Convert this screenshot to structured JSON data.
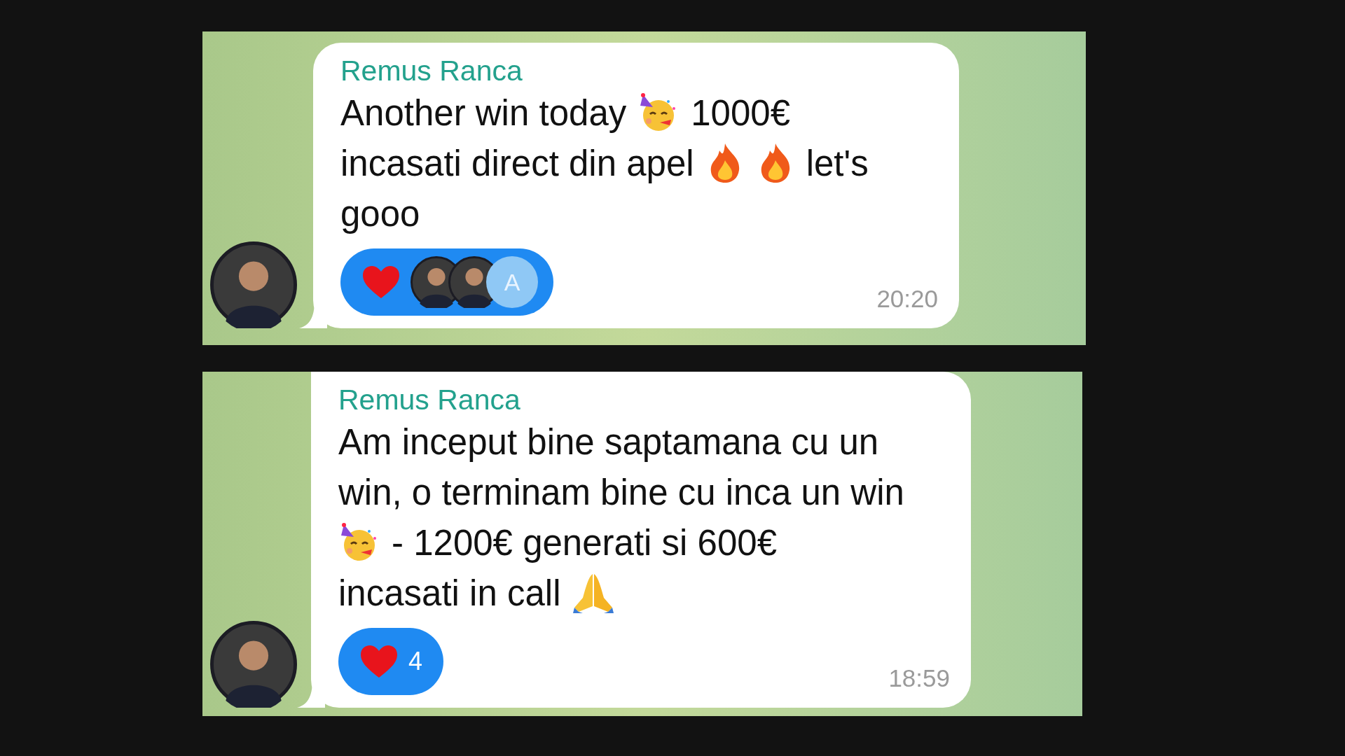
{
  "messages": [
    {
      "sender": "Remus Ranca",
      "lines": [
        [
          {
            "kind": "text",
            "text": "Another win today"
          },
          {
            "kind": "party"
          },
          {
            "kind": "text",
            "text": "1000€"
          }
        ],
        [
          {
            "kind": "text",
            "text": "incasati direct din apel"
          },
          {
            "kind": "fire"
          },
          {
            "kind": "fire"
          },
          {
            "kind": "text",
            "text": "let's"
          }
        ],
        [
          {
            "kind": "text",
            "text": "gooo"
          }
        ]
      ],
      "reaction": {
        "reactors": [
          {
            "kind": "photo"
          },
          {
            "kind": "photo"
          },
          {
            "kind": "initial",
            "initial": "A"
          }
        ]
      },
      "time": "20:20"
    },
    {
      "sender": "Remus Ranca",
      "lines": [
        [
          {
            "kind": "text",
            "text": "Am inceput bine saptamana cu un"
          }
        ],
        [
          {
            "kind": "text",
            "text": "win, o terminam bine cu inca un win"
          }
        ],
        [
          {
            "kind": "party"
          },
          {
            "kind": "text",
            "text": "- 1200€ generati si 600€"
          }
        ],
        [
          {
            "kind": "text",
            "text": "incasati in call"
          },
          {
            "kind": "pray"
          }
        ]
      ],
      "reaction": {
        "count": "4"
      },
      "time": "18:59"
    }
  ]
}
